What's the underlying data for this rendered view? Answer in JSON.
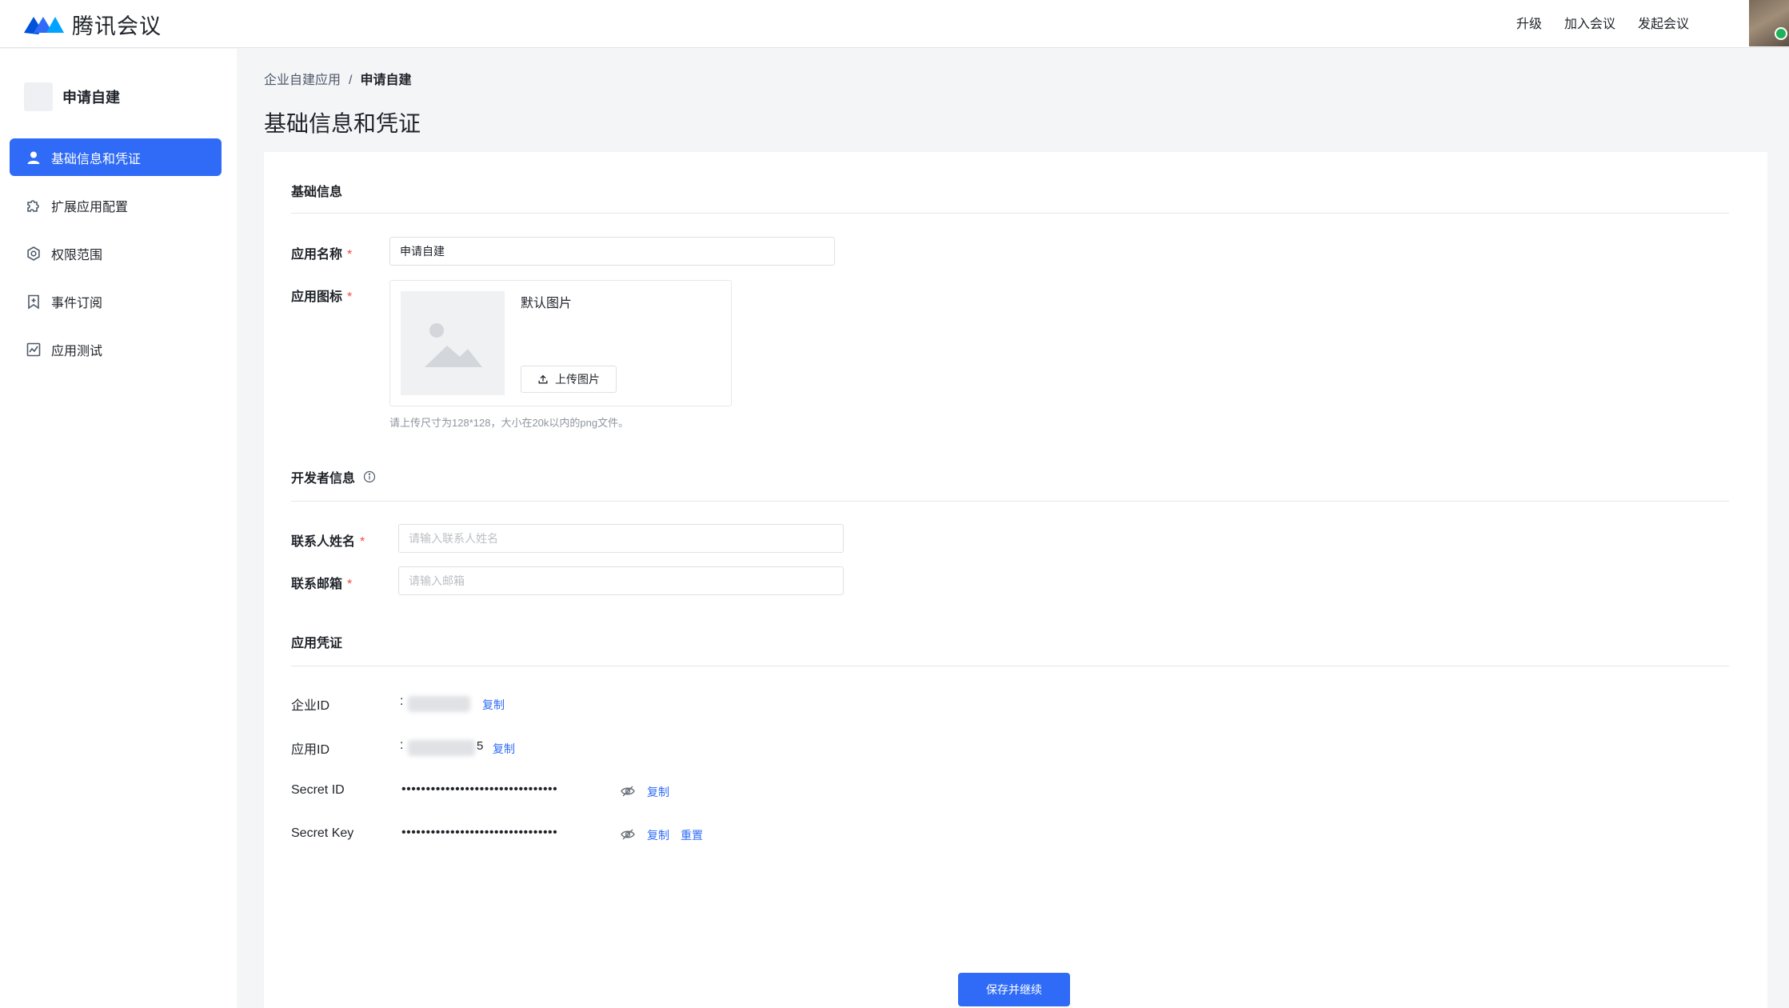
{
  "header": {
    "app_name": "腾讯会议",
    "nav": [
      {
        "label": "升级"
      },
      {
        "label": "加入会议"
      },
      {
        "label": "发起会议"
      }
    ]
  },
  "sidebar": {
    "app_title": "申请自建",
    "items": [
      {
        "label": "基础信息和凭证",
        "icon": "user-icon",
        "active": true
      },
      {
        "label": "扩展应用配置",
        "icon": "puzzle-icon",
        "active": false
      },
      {
        "label": "权限范围",
        "icon": "gear-icon",
        "active": false
      },
      {
        "label": "事件订阅",
        "icon": "bookmark-icon",
        "active": false
      },
      {
        "label": "应用测试",
        "icon": "chart-icon",
        "active": false
      }
    ]
  },
  "breadcrumb": {
    "parent": "企业自建应用",
    "separator": "/",
    "current": "申请自建"
  },
  "page_title": "基础信息和凭证",
  "basic_info": {
    "section_title": "基础信息",
    "app_name_label": "应用名称",
    "app_name_value": "申请自建",
    "app_icon_label": "应用图标",
    "default_image_label": "默认图片",
    "upload_label": "上传图片",
    "upload_hint": "请上传尺寸为128*128，大小在20k以内的png文件。"
  },
  "developer_info": {
    "section_title": "开发者信息",
    "contact_name_label": "联系人姓名",
    "contact_name_placeholder": "请输入联系人姓名",
    "contact_email_label": "联系邮箱",
    "contact_email_placeholder": "请输入邮箱"
  },
  "credentials": {
    "section_title": "应用凭证",
    "corp_id_label": "企业ID",
    "app_id_label": "应用ID",
    "app_id_tail": "5",
    "secret_id_label": "Secret ID",
    "secret_key_label": "Secret Key",
    "masked_value": "••••••••••••••••••••••••••••••••",
    "colon": ":",
    "copy_label": "复制",
    "reset_label": "重置"
  },
  "required_mark": "*",
  "footer": {
    "save_label": "保存并继续"
  },
  "colors": {
    "primary": "#2f6bf6",
    "required": "#f54a45",
    "page_bg": "#f4f5f7"
  }
}
